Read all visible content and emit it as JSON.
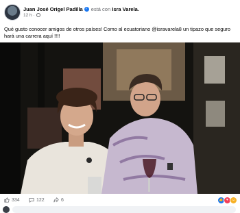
{
  "post": {
    "author": "Juan José Origel Padilla",
    "with_text": "está con",
    "tagged": "Isra Varela.",
    "time": "12 h",
    "caption": "Qué gusto conocer amigos de otros países! Como al ecuatoriano @isravarela8 un tipazo que seguro hará una carrera aquí !!!!"
  },
  "stats": {
    "likes": "334",
    "comments": "122",
    "shares": "6"
  },
  "icons": {
    "avatar": "profile-avatar",
    "verified": "verified-badge-icon",
    "audience": "globe-icon",
    "like": "like-icon",
    "comment": "comment-icon",
    "share": "share-icon",
    "reactions": [
      "like-reaction",
      "love-reaction",
      "haha-reaction"
    ]
  },
  "colors": {
    "accent": "#1877f2",
    "secondary_text": "#65676b"
  }
}
